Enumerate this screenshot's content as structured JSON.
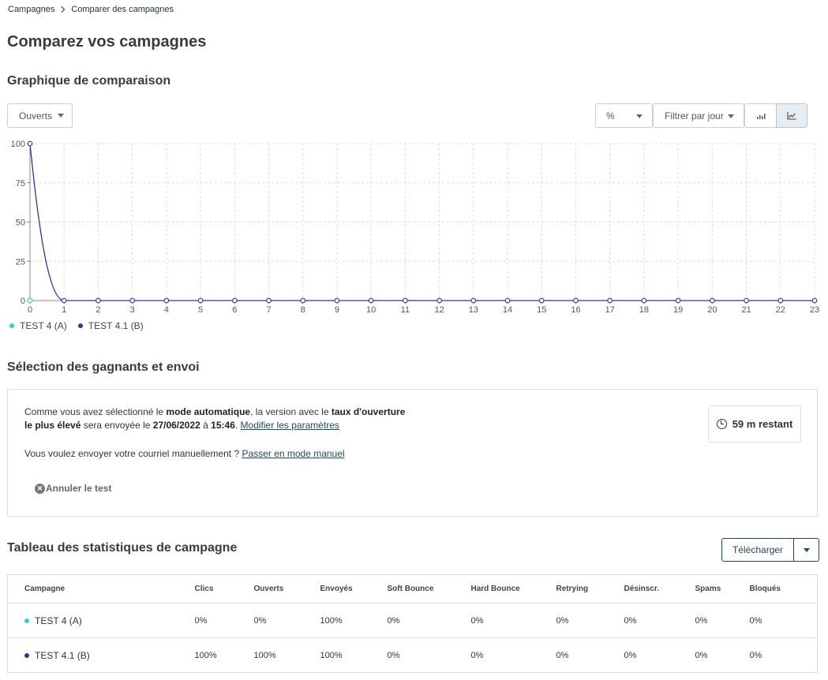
{
  "breadcrumb": {
    "root": "Campagnes",
    "current": "Comparer des campagnes"
  },
  "page_title": "Comparez vos campagnes",
  "chart_section": {
    "title": "Graphique de comparaison",
    "metric_select": "Ouverts",
    "unit_select": "%",
    "filter_select": "Filtrer par jour",
    "bar_view_icon": "bar-chart-icon",
    "line_view_icon": "line-chart-icon"
  },
  "chart_data": {
    "type": "line",
    "x": [
      0,
      1,
      2,
      3,
      4,
      5,
      6,
      7,
      8,
      9,
      10,
      11,
      12,
      13,
      14,
      15,
      16,
      17,
      18,
      19,
      20,
      21,
      22,
      23
    ],
    "ylim": [
      0,
      100
    ],
    "yticks": [
      0,
      25,
      50,
      75,
      100
    ],
    "grid": true,
    "legend_position": "bottom-left",
    "series": [
      {
        "name": "TEST 4 (A)",
        "color": "#2ed3c9",
        "values": [
          0
        ]
      },
      {
        "name": "TEST 4.1 (B)",
        "color": "#3b2fa0",
        "values": [
          100,
          0,
          0,
          0,
          0,
          0,
          0,
          0,
          0,
          0,
          0,
          0,
          0,
          0,
          0,
          0,
          0,
          0,
          0,
          0,
          0,
          0,
          0,
          0
        ]
      }
    ]
  },
  "winner_section": {
    "title": "Sélection des gagnants et envoi",
    "text_1": "Comme vous avez sélectionné le ",
    "bold_1": "mode automatique",
    "text_2": ", la version avec le ",
    "bold_2": "taux d'ouverture",
    "bold_3": "le plus élevé",
    "text_3": " sera envoyée le ",
    "bold_4": "27/06/2022",
    "text_4": " à ",
    "bold_5": "15:46",
    "text_5": ". ",
    "modify_link": "Modifier les paramètres",
    "manual_text": "Vous voulez envoyer votre courriel manuellement ? ",
    "manual_link": "Passer en mode manuel",
    "cancel_label": "Annuler le test",
    "timer": "59 m restant"
  },
  "stats_section": {
    "title": "Tableau des statistiques de campagne",
    "download_label": "Télécharger",
    "columns": [
      "Campagne",
      "Clics",
      "Ouverts",
      "Envoyés",
      "Soft Bounce",
      "Hard Bounce",
      "Retrying",
      "Désinscr.",
      "Spams",
      "Bloqués"
    ],
    "rows": [
      {
        "color": "#2ed3c9",
        "cells": [
          "TEST 4 (A)",
          "0%",
          "0%",
          "100%",
          "0%",
          "0%",
          "0%",
          "0%",
          "0%",
          "0%"
        ]
      },
      {
        "color": "#3b2fa0",
        "cells": [
          "TEST 4.1 (B)",
          "100%",
          "100%",
          "100%",
          "0%",
          "0%",
          "0%",
          "0%",
          "0%",
          "0%"
        ]
      }
    ]
  }
}
